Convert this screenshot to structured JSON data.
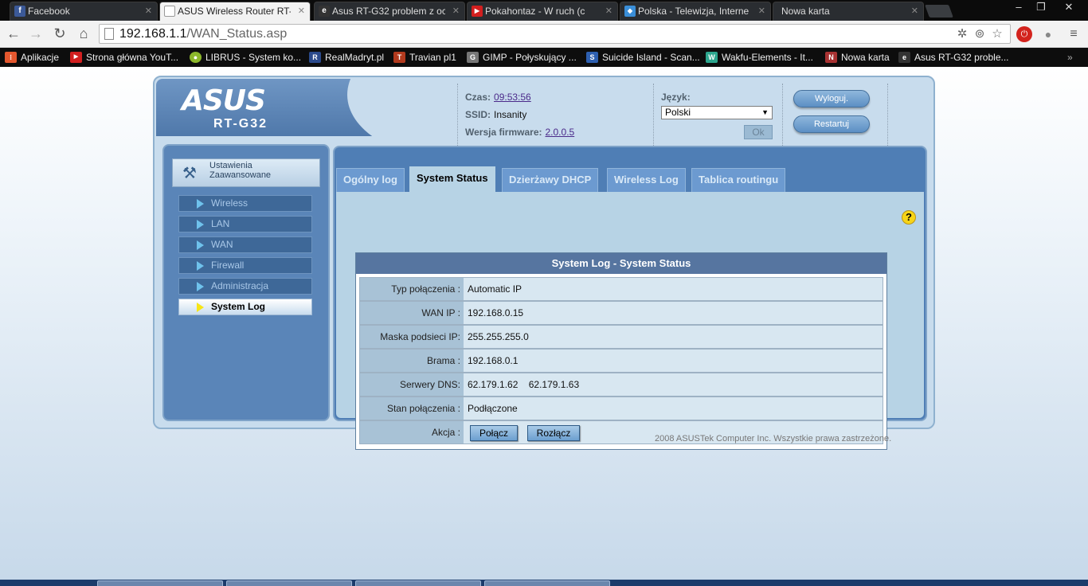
{
  "browser": {
    "tabs": [
      {
        "label": "Facebook",
        "icon": "facebook-icon",
        "color": "#3b5998",
        "glyph": "f"
      },
      {
        "label": "ASUS Wireless Router RT-G",
        "icon": "page-icon",
        "color": "#cccccc",
        "glyph": ""
      },
      {
        "label": "Asus RT-G32 problem z oc",
        "icon": "site-icon",
        "color": "#333333",
        "glyph": "e"
      },
      {
        "label": "Pokahontaz - W ruch (c",
        "icon": "youtube-icon",
        "color": "#d21f1f",
        "glyph": "▶"
      },
      {
        "label": "Polska - Telewizja, Interne",
        "icon": "flame-icon",
        "color": "#3a8ed8",
        "glyph": "◆"
      },
      {
        "label": "Nowa karta",
        "icon": "",
        "color": "",
        "glyph": ""
      }
    ],
    "url_host": "192.168.1.1",
    "url_path": "/WAN_Status.asp",
    "bookmarks": [
      {
        "label": "Aplikacje",
        "icon": "apps-icon",
        "color": "#e4572e",
        "glyph": "⁝"
      },
      {
        "label": "Strona główna YouT...",
        "icon": "youtube-icon",
        "color": "#d21f1f",
        "glyph": "▶"
      },
      {
        "label": "LIBRUS - System ko...",
        "icon": "librus-icon",
        "color": "#8cb82b",
        "glyph": "●"
      },
      {
        "label": "RealMadryt.pl",
        "icon": "realmadryt-icon",
        "color": "#2b4a8c",
        "glyph": "R"
      },
      {
        "label": "Travian pl1",
        "icon": "travian-icon",
        "color": "#b23a1e",
        "glyph": "T"
      },
      {
        "label": "GIMP - Połyskujący ...",
        "icon": "gimp-icon",
        "color": "#777777",
        "glyph": "G"
      },
      {
        "label": "Suicide Island - Scan...",
        "icon": "doc-icon",
        "color": "#2d5fb0",
        "glyph": "S"
      },
      {
        "label": "Wakfu-Elements - It...",
        "icon": "wakfu-icon",
        "color": "#2ca58d",
        "glyph": "W"
      },
      {
        "label": "Nowa karta",
        "icon": "newtab-icon",
        "color": "#a83232",
        "glyph": "N"
      },
      {
        "label": "Asus RT-G32 proble...",
        "icon": "site-icon",
        "color": "#333333",
        "glyph": "e"
      }
    ]
  },
  "router": {
    "brand": "ASUS",
    "model": "RT-G32",
    "time_label": "Czas:",
    "time_value": "09:53:56",
    "ssid_label": "SSID:",
    "ssid_value": "Insanity",
    "fw_label": "Wersja firmware:",
    "fw_value": "2.0.0.5",
    "lang_label": "Język:",
    "lang_value": "Polski",
    "ok_label": "Ok",
    "logout_label": "Wyloguj.",
    "restart_label": "Restartuj"
  },
  "sidebar": {
    "title_line1": "Ustawienia",
    "title_line2": "Zaawansowane",
    "items": [
      {
        "label": "Wireless"
      },
      {
        "label": "LAN"
      },
      {
        "label": "WAN"
      },
      {
        "label": "Firewall"
      },
      {
        "label": "Administracja"
      },
      {
        "label": "System Log"
      }
    ]
  },
  "tabs": [
    {
      "label": "Ogólny log"
    },
    {
      "label": "System Status"
    },
    {
      "label": "Dzierżawy DHCP"
    },
    {
      "label": "Wireless Log"
    },
    {
      "label": "Tablica routingu"
    }
  ],
  "status": {
    "title": "System Log - System Status",
    "rows": [
      {
        "key": "Typ połączenia :",
        "value": "Automatic IP"
      },
      {
        "key": "WAN IP :",
        "value": "192.168.0.15"
      },
      {
        "key": "Maska podsieci IP:",
        "value": "255.255.255.0"
      },
      {
        "key": "Brama :",
        "value": "192.168.0.1"
      },
      {
        "key": "Serwery DNS:",
        "value": "62.179.1.62    62.179.1.63"
      },
      {
        "key": "Stan połączenia :",
        "value": "Podłączone"
      },
      {
        "key": "Akcja :",
        "value": ""
      }
    ],
    "connect_label": "Połącz",
    "disconnect_label": "Rozłącz"
  },
  "footer": "2008 ASUSTek Computer Inc. Wszystkie prawa zastrzeżone."
}
